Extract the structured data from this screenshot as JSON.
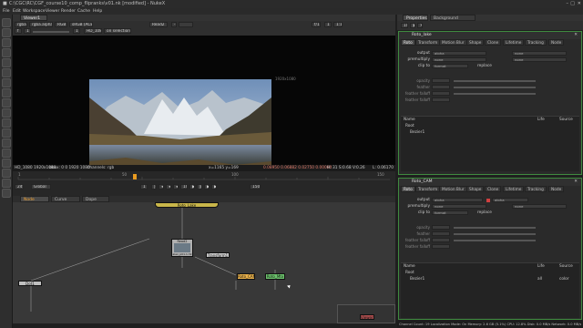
{
  "window": {
    "title": "C:\\CGC\\RC\\CGF_course10_comp_flipranks\\v01.nk [modified] - NukeX"
  },
  "menu": [
    "File",
    "Edit",
    "Workspace",
    "Viewer",
    "Render",
    "Cache",
    "Help"
  ],
  "viewer": {
    "tab": "Viewer1",
    "channels": "rgba",
    "layer": "rgba.alpha",
    "rgb": "RGB",
    "colorspace": "sRGB (ACES)",
    "input_a": "Read2",
    "input_b": "",
    "zoom": "f/1.0",
    "gain": "1",
    "roi": "HD_1080",
    "proxy": "1:1",
    "selection": "on selection",
    "format_label": "HD_1080 1920x1080",
    "bbox": "bbox: 0 0 1920 1080",
    "channels_info": "channels: rgb",
    "coords": "x=1165 y=169",
    "pixel": "0.08950  0.06882  0.02750  0.00000",
    "hsv": "H: 31 S:0.68 V:0.26",
    "luma": "L: 0.06170",
    "corner_label": "1920x1080"
  },
  "timeline": {
    "frame": "1",
    "fps": "24*",
    "range_mode": "Global",
    "ticks": [
      "1",
      "50",
      "100",
      "150"
    ],
    "step": "10",
    "end_frame": "150"
  },
  "graph_tabs": [
    {
      "label": "Node Graph",
      "active": true,
      "orange": true
    },
    {
      "label": "Curve Editor",
      "active": false
    },
    {
      "label": "Dope Sheet",
      "active": false
    }
  ],
  "nodes": {
    "read": "Read2",
    "read_sub": "alex_p01.1.3k",
    "roto_a": "Roto_CAM",
    "roto_b": "Roto_Mtx",
    "transform": "Transform1",
    "viewer_node": "Viewer1",
    "dot": "Dot1",
    "top_node": "Roto_Lake"
  },
  "properties_tabs": [
    {
      "label": "Properties",
      "active": true
    },
    {
      "label": "Background Renders",
      "active": false
    }
  ],
  "panel1": {
    "name": "Roto_lake",
    "tabs": [
      "Roto",
      "Transform",
      "Motion Blur",
      "Shape",
      "Clone",
      "Lifetime",
      "Tracking",
      "Node"
    ],
    "output_label": "output",
    "output": "alpha",
    "output_b": "none",
    "premult_label": "premultiply",
    "premult": "none",
    "clip_label": "clip to",
    "clip": "format",
    "replace": "replace",
    "fields": [
      "opacity",
      "feather",
      "feather falloff",
      "feather falloff"
    ],
    "layer_header": "Name",
    "layers": [
      "Root",
      "Bezier1"
    ],
    "layer_cols": [
      "Life",
      "Source"
    ]
  },
  "panel2": {
    "name": "Roto_CAM",
    "tabs": [
      "Roto",
      "Transform",
      "Motion Blur",
      "Shape",
      "Clone",
      "Lifetime",
      "Tracking",
      "Node"
    ],
    "output_label": "output",
    "output": "alpha",
    "output_b": "alpha",
    "premult_label": "premultiply",
    "premult": "none",
    "clip_label": "clip to",
    "clip": "format",
    "replace": "replace",
    "fields": [
      "opacity",
      "feather",
      "feather falloff",
      "feather falloff"
    ],
    "layer_header": "Name",
    "layers": [
      "Root",
      "Bezier1"
    ],
    "layer_cols": [
      "Life",
      "Source"
    ],
    "life_val": "all",
    "source_val": "color"
  },
  "status": "Channel Count: 19  Localization Mode: On  Memory: 2.6 GB (5.1%)  CPU: 12.8%  Disk: 0.0 MB/s  Network: 0.0 MB/s",
  "colors": {
    "panel_border": "#3f8a3f",
    "read_node": "#b0b0b0",
    "roto_node": "#e8b04a",
    "roto2_node": "#6cc26c",
    "top_node": "#e8cc4a",
    "timeline_marker": "#e89b20"
  }
}
